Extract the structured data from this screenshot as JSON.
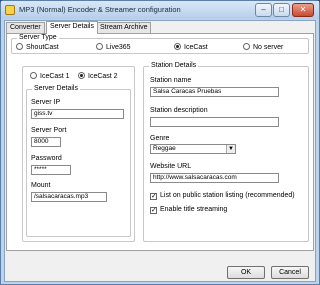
{
  "window": {
    "title": "MP3 (Normal) Encoder & Streamer configuration",
    "minimize": "–",
    "maximize": "□",
    "close": "✕"
  },
  "tabs": [
    {
      "label": "Converter"
    },
    {
      "label": "Server Details"
    },
    {
      "label": "Stream Archive"
    }
  ],
  "server_type": {
    "legend": "Server Type",
    "options": [
      "ShoutCast",
      "Live365",
      "IceCast",
      "No server"
    ],
    "selected": "IceCast"
  },
  "icecast_version": {
    "options": [
      "IceCast 1",
      "IceCast 2"
    ],
    "selected": "IceCast 2"
  },
  "server_details": {
    "legend": "Server Details",
    "server_ip_label": "Server IP",
    "server_ip": "giss.tv",
    "server_port_label": "Server Port",
    "server_port": "8000",
    "password_label": "Password",
    "password": "*****",
    "mount_label": "Mount",
    "mount": "/salsacaracas.mp3"
  },
  "station_details": {
    "legend": "Station Details",
    "station_name_label": "Station name",
    "station_name": "Salsa Caracas Pruebas",
    "station_description_label": "Station description",
    "station_description": "",
    "genre_label": "Genre",
    "genre": "Reggae",
    "website_url_label": "Website URL",
    "website_url": "http://www.salsacaracas.com",
    "list_public_label": "List on public station listing (recommended)",
    "list_public_checked": true,
    "title_streaming_label": "Enable title streaming",
    "title_streaming_checked": true
  },
  "buttons": {
    "ok": "OK",
    "cancel": "Cancel"
  }
}
